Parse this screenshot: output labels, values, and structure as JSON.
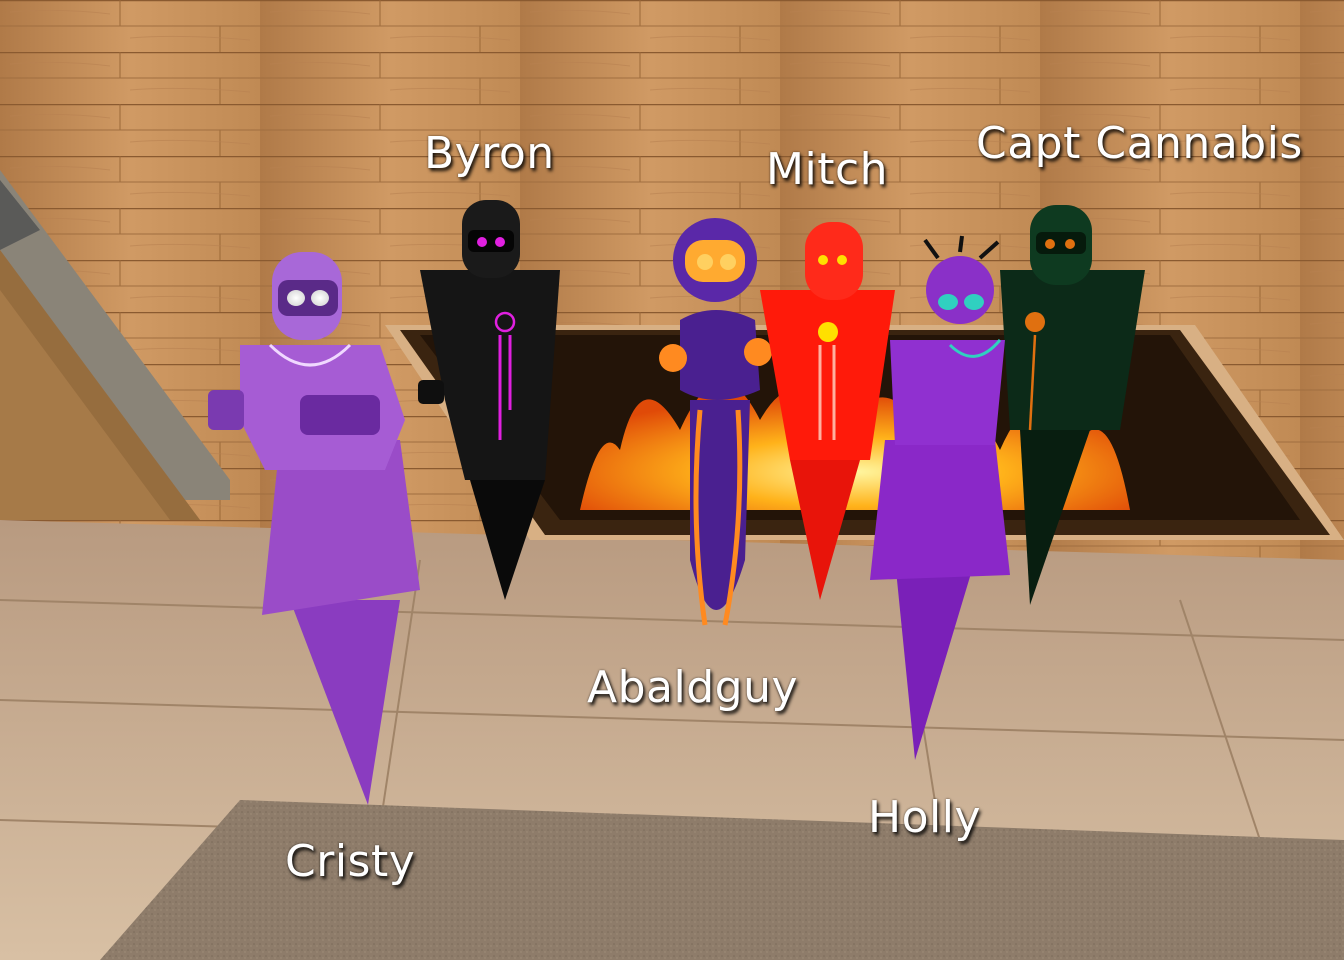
{
  "scene": {
    "description_visible": false
  },
  "avatars": [
    {
      "id": "byron",
      "name": "Byron",
      "color": "#151515",
      "accent": "#e020e0"
    },
    {
      "id": "mitch",
      "name": "Mitch",
      "color": "#ff1a0a",
      "accent": "#ffe000"
    },
    {
      "id": "capt-cannabis",
      "name": "Capt Cannabis",
      "color": "#0c2a18",
      "accent": "#e07010"
    },
    {
      "id": "abaldguy",
      "name": "Abaldguy",
      "color": "#4a2090",
      "accent": "#ff8a20"
    },
    {
      "id": "holly",
      "name": "Holly",
      "color": "#8a28c8",
      "accent": "#30d0c0"
    },
    {
      "id": "cristy",
      "name": "Cristy",
      "color": "#9a4cc8",
      "accent": "#ffffff"
    }
  ],
  "colors": {
    "wall_wood": "#c8925e",
    "floor_tile": "#c4a888",
    "rug": "#8c7a68",
    "fire": "#ffb020"
  }
}
